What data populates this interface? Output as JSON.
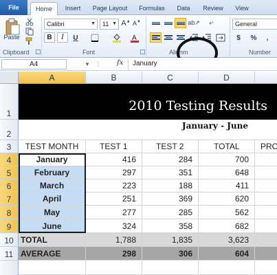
{
  "ribbon": {
    "tabs": [
      "File",
      "Home",
      "Insert",
      "Page Layout",
      "Formulas",
      "Data",
      "Review",
      "View"
    ],
    "active_tab": "Home",
    "clipboard": {
      "paste_label": "Paste",
      "group_label": "Clipboard"
    },
    "font": {
      "name": "Calibri",
      "size": "11",
      "bold": "B",
      "italic": "I",
      "group_label": "Font"
    },
    "alignment": {
      "group_label": "Alignm"
    },
    "number": {
      "format": "General",
      "dollar": "$",
      "percent": "%",
      "group_label": "Number"
    }
  },
  "formula_bar": {
    "name_box": "A4",
    "fx": "fx",
    "value": "January"
  },
  "grid": {
    "columns": [
      "A",
      "B",
      "C",
      "D"
    ],
    "rows": [
      "1",
      "2",
      "3",
      "4",
      "5",
      "6",
      "7",
      "8",
      "9",
      "10",
      "11"
    ],
    "title": "2010 Testing Results",
    "subtitle": "January - June",
    "headers": [
      "TEST MONTH",
      "TEST 1",
      "TEST 2",
      "TOTAL",
      "PRO"
    ],
    "data": [
      [
        "January",
        "416",
        "284",
        "700"
      ],
      [
        "February",
        "297",
        "351",
        "648"
      ],
      [
        "March",
        "223",
        "188",
        "411"
      ],
      [
        "April",
        "251",
        "369",
        "620"
      ],
      [
        "May",
        "277",
        "285",
        "562"
      ],
      [
        "June",
        "324",
        "358",
        "682"
      ]
    ],
    "total": [
      "TOTAL",
      "1,788",
      "1,835",
      "3,623"
    ],
    "average": [
      "AVERAGE",
      "298",
      "306",
      "604"
    ]
  },
  "colors": {
    "file_tab": "#2a64ad",
    "selection": "#c6dcf4",
    "header_highlight": "#f1c24d",
    "banner": "#000000"
  }
}
